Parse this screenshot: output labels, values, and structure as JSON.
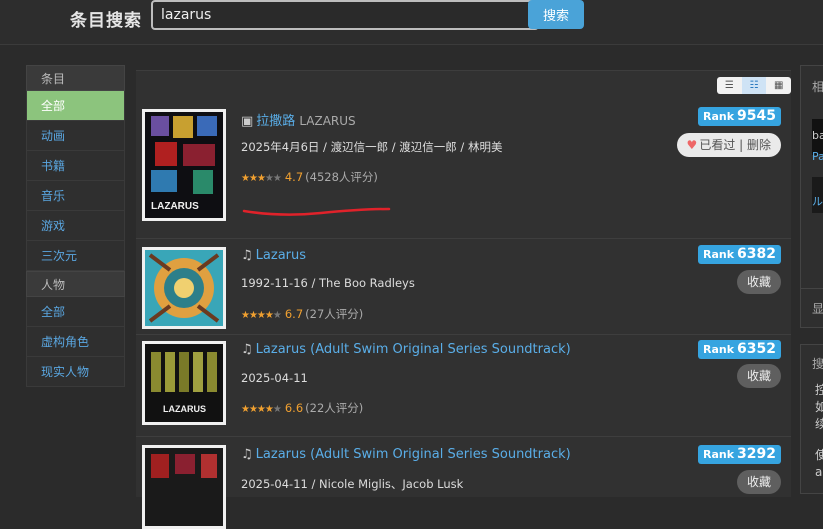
{
  "search": {
    "label": "条目搜索",
    "query": "lazarus",
    "button": "搜索"
  },
  "sidebar": {
    "groups": [
      {
        "title": "条目",
        "items": [
          "全部",
          "动画",
          "书籍",
          "音乐",
          "游戏",
          "三次元"
        ]
      },
      {
        "title": "人物",
        "items": [
          "全部",
          "虚构角色",
          "现实人物"
        ]
      }
    ]
  },
  "view_modes": [
    "list-icon",
    "list-detail-icon",
    "grid-icon"
  ],
  "results": [
    {
      "type_icon": "tv-icon",
      "title": "拉撒路",
      "subtitle": "LAZARUS",
      "info": "2025年4月6日 / 渡辺信一郎 / 渡辺信一郎 / 林明美",
      "score": "4.7",
      "count": "(4528人评分)",
      "rank_label": "Rank",
      "rank": "9545",
      "action": "已看过 | 删除",
      "stars": 2.5
    },
    {
      "type_icon": "music-icon",
      "title": "Lazarus",
      "subtitle": "",
      "info": "1992-11-16 / The Boo Radleys",
      "score": "6.7",
      "count": "(27人评分)",
      "rank_label": "Rank",
      "rank": "6382",
      "action": "收藏",
      "stars": 3.5
    },
    {
      "type_icon": "music-icon",
      "title": "Lazarus (Adult Swim Original Series Soundtrack)",
      "subtitle": "",
      "info": "2025-04-11",
      "score": "6.6",
      "count": "(22人评分)",
      "rank_label": "Rank",
      "rank": "6352",
      "action": "收藏",
      "stars": 3.5
    },
    {
      "type_icon": "music-icon",
      "title": "Lazarus (Adult Swim Original Series Soundtrack)",
      "subtitle": "",
      "info": "2025-04-11 / Nicole Miglis、Jacob Lusk",
      "score": "",
      "count": "",
      "rank_label": "Rank",
      "rank": "3292",
      "action": "收藏",
      "stars": 0
    }
  ],
  "right_panel": {
    "box1": "相",
    "box1_items": [
      "ba",
      "Pa",
      "ル"
    ],
    "box2": "显",
    "box3": "搜",
    "box3_lines": [
      "控",
      "如",
      "续",
      "使",
      "a"
    ]
  },
  "colors": {
    "accent": "#36a4e0",
    "active_green": "#8cc47d",
    "link": "#5aaee8",
    "star": "#f0a030"
  }
}
